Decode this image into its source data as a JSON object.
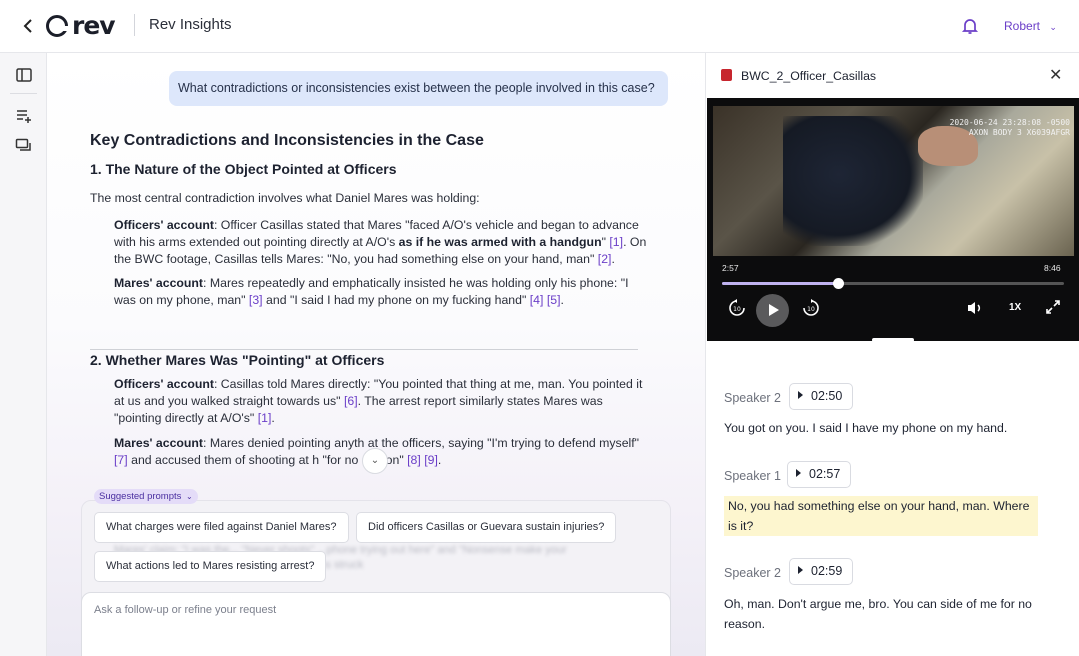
{
  "header": {
    "logo_text": "rev",
    "app_title": "Rev Insights",
    "user_name": "Robert"
  },
  "chat": {
    "user_message": "What contradictions or inconsistencies exist between the people involved in this case?",
    "answer_title": "Key Contradictions and Inconsistencies in the Case",
    "section1": {
      "heading": "1. The Nature of the Object Pointed at Officers",
      "intro": "The most central contradiction involves what Daniel Mares was holding:",
      "officers_label": "Officers' account",
      "officers_text_1": ": Officer Casillas stated that Mares \"faced A/O's vehicle and began to advance with his arms extended out pointing directly at A/O's ",
      "officers_bold": "as if he was armed with a handgun",
      "officers_text_2": "\" ",
      "cite_1": "[1]",
      "officers_text_3": ". On the BWC footage, Casillas tells Mares: \"No, you had something else on your hand, man\" ",
      "cite_2": "[2]",
      "officers_text_4": ".",
      "mares_label": "Mares' account",
      "mares_text_1": ": Mares repeatedly and emphatically insisted he was holding only his phone: \"I was on my phone, man\" ",
      "cite_3": "[3]",
      "mares_text_2": " and \"I said I had my phone on my fucking hand\" ",
      "cite_4": "[4]",
      "cite_5": "[5]",
      "mares_text_3": "."
    },
    "section2": {
      "heading": "2. Whether Mares Was \"Pointing\" at Officers",
      "officers_label": "Officers' account",
      "officers_text_1": ": Casillas told Mares directly: \"You pointed that thing at me, man. You pointed it at us and you walked straight towards us\" ",
      "cite_6": "[6]",
      "officers_text_2": ". The arrest report similarly states Mares was \"pointing directly at A/O's\" ",
      "cite_1": "[1]",
      "officers_text_3": ".",
      "mares_label": "Mares' account",
      "mares_text_1": ": Mares denied pointing anyth     at the officers, saying \"I'm trying to defend myself\" ",
      "cite_7": "[7]",
      "mares_text_2": " and accused them of shooting at h     \"for no reason\" ",
      "cite_8": "[8]",
      "cite_9": "[9]",
      "mares_text_3": "."
    },
    "suggested_label": "Suggested prompts",
    "prompts": [
      "What charges were filed against Daniel Mares?",
      "Did officers Casillas or Guevara sustain injuries?",
      "What actions led to Mares resisting arrest?"
    ],
    "input_placeholder": "Ask a follow-up or refine your request"
  },
  "media": {
    "file_name": "BWC_2_Officer_Casillas",
    "stamp_line1": "2020-06-24 23:28:08 -0500",
    "stamp_line2": "AXON BODY 3 X6039AFGR",
    "current_time": "2:57",
    "duration": "8:46",
    "progress": 0.34,
    "speed": "1X"
  },
  "transcript": [
    {
      "speaker": "Speaker 2",
      "time": "02:50",
      "text": "You got on you. I said I have my phone on my hand.",
      "highlighted": false
    },
    {
      "speaker": "Speaker 1",
      "time": "02:57",
      "text": "No, you had something else on your hand, man. Where is it?",
      "highlighted": true
    },
    {
      "speaker": "Speaker 2",
      "time": "02:59",
      "text": "Oh, man. Don't argue me, bro. You can side of me for no reason.",
      "highlighted": false
    }
  ],
  "colors": {
    "accent": "#6b3fc8",
    "user_bubble": "#dde7fb",
    "highlight": "#fdf6cf",
    "file_icon": "#c7262e"
  }
}
